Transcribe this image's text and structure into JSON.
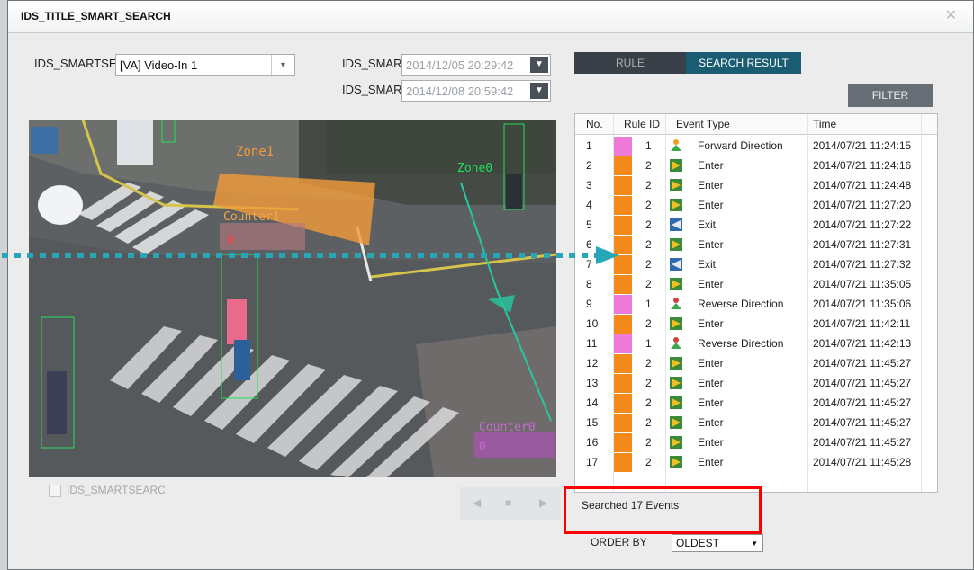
{
  "window": {
    "title": "IDS_TITLE_SMART_SEARCH",
    "close_glyph": "✕"
  },
  "top_controls": {
    "camera_label": "IDS_SMARTSEA",
    "camera_value": "[VA] Video-In 1",
    "start_label": "IDS_SMART",
    "start_value": "2014/12/05 20:29:42",
    "end_label": "IDS_SMART",
    "end_value": "2014/12/08 20:59:42"
  },
  "tabs": [
    {
      "label": "RULE",
      "active": false
    },
    {
      "label": "SEARCH RESULT",
      "active": true
    }
  ],
  "filter_label": "FILTER",
  "video_overlay": {
    "zone1": "Zone1",
    "zone0": "Zone0",
    "counter1": "Counter1",
    "counter1_value": "0",
    "counter0": "Counter0",
    "counter0_value": "0"
  },
  "table": {
    "headers": [
      "No.",
      "Rule ID",
      "Event Type",
      "Time"
    ],
    "rows": [
      {
        "no": "1",
        "rule": "1",
        "type": "Forward Direction",
        "time": "2014/07/21 11:24:15",
        "color": "#ee7bd8",
        "icon": "direction-icon"
      },
      {
        "no": "2",
        "rule": "2",
        "type": "Enter",
        "time": "2014/07/21 11:24:16",
        "color": "#f48a1c",
        "icon": "enter-icon"
      },
      {
        "no": "3",
        "rule": "2",
        "type": "Enter",
        "time": "2014/07/21 11:24:48",
        "color": "#f48a1c",
        "icon": "enter-icon"
      },
      {
        "no": "4",
        "rule": "2",
        "type": "Enter",
        "time": "2014/07/21 11:27:20",
        "color": "#f48a1c",
        "icon": "enter-icon"
      },
      {
        "no": "5",
        "rule": "2",
        "type": "Exit",
        "time": "2014/07/21 11:27:22",
        "color": "#f48a1c",
        "icon": "exit-icon"
      },
      {
        "no": "6",
        "rule": "2",
        "type": "Enter",
        "time": "2014/07/21 11:27:31",
        "color": "#f48a1c",
        "icon": "enter-icon"
      },
      {
        "no": "7",
        "rule": "2",
        "type": "Exit",
        "time": "2014/07/21 11:27:32",
        "color": "#f48a1c",
        "icon": "exit-icon"
      },
      {
        "no": "8",
        "rule": "2",
        "type": "Enter",
        "time": "2014/07/21 11:35:05",
        "color": "#f48a1c",
        "icon": "enter-icon"
      },
      {
        "no": "9",
        "rule": "1",
        "type": "Reverse Direction",
        "time": "2014/07/21 11:35:06",
        "color": "#ee7bd8",
        "icon": "reverse-direction-icon"
      },
      {
        "no": "10",
        "rule": "2",
        "type": "Enter",
        "time": "2014/07/21 11:42:11",
        "color": "#f48a1c",
        "icon": "enter-icon"
      },
      {
        "no": "11",
        "rule": "1",
        "type": "Reverse Direction",
        "time": "2014/07/21 11:42:13",
        "color": "#ee7bd8",
        "icon": "reverse-direction-icon"
      },
      {
        "no": "12",
        "rule": "2",
        "type": "Enter",
        "time": "2014/07/21 11:45:27",
        "color": "#f48a1c",
        "icon": "enter-icon"
      },
      {
        "no": "13",
        "rule": "2",
        "type": "Enter",
        "time": "2014/07/21 11:45:27",
        "color": "#f48a1c",
        "icon": "enter-icon"
      },
      {
        "no": "14",
        "rule": "2",
        "type": "Enter",
        "time": "2014/07/21 11:45:27",
        "color": "#f48a1c",
        "icon": "enter-icon"
      },
      {
        "no": "15",
        "rule": "2",
        "type": "Enter",
        "time": "2014/07/21 11:45:27",
        "color": "#f48a1c",
        "icon": "enter-icon"
      },
      {
        "no": "16",
        "rule": "2",
        "type": "Enter",
        "time": "2014/07/21 11:45:27",
        "color": "#f48a1c",
        "icon": "enter-icon"
      },
      {
        "no": "17",
        "rule": "2",
        "type": "Enter",
        "time": "2014/07/21 11:45:28",
        "color": "#f48a1c",
        "icon": "enter-icon"
      }
    ]
  },
  "status_text": "Searched 17 Events",
  "order": {
    "label": "ORDER BY",
    "value": "OLDEST"
  },
  "checkbox_label": "IDS_SMARTSEARC",
  "playback": {
    "prev": "◀",
    "stop": "■",
    "next": "▶"
  },
  "colors": {
    "accent_tab": "#1a5d72",
    "highlight_box": "#ff0000",
    "arrow": "#26a6b6"
  }
}
